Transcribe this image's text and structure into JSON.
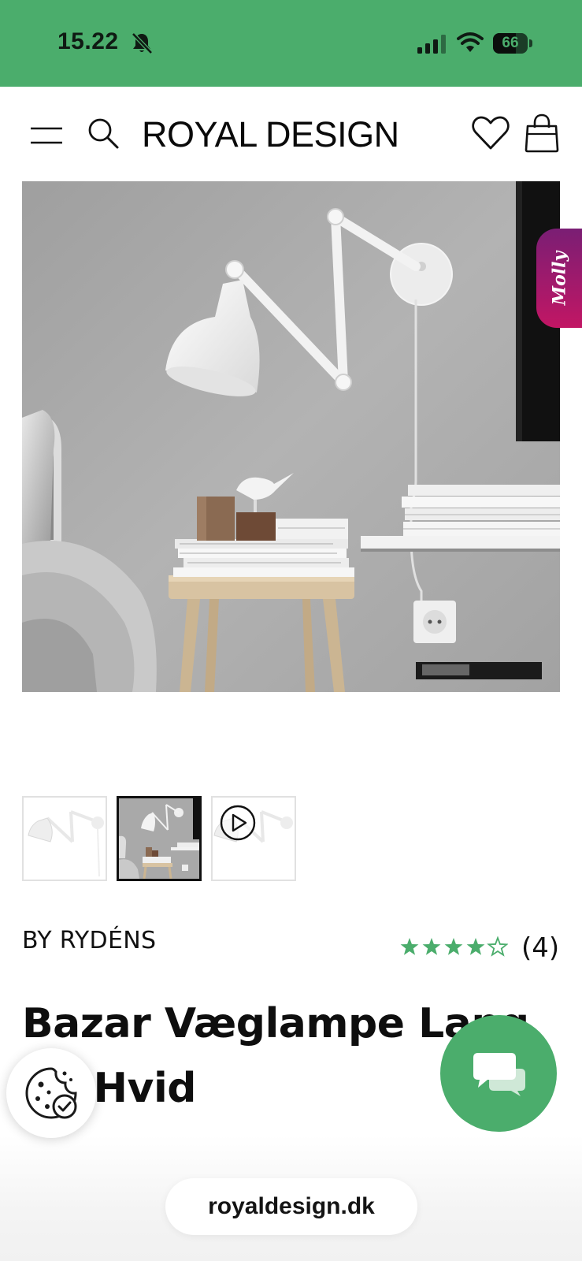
{
  "status_bar": {
    "time": "15.22",
    "battery_level": "66",
    "background_color": "#4bad6c",
    "icons": [
      "bell-slash-icon",
      "cellular-signal-icon",
      "wifi-icon",
      "battery-icon"
    ]
  },
  "header": {
    "logo": "ROYAL DESIGN",
    "icons": [
      "menu-icon",
      "search-icon",
      "heart-icon",
      "shopping-bag-icon"
    ]
  },
  "gallery": {
    "thumbnails": [
      {
        "kind": "product-image",
        "active": false
      },
      {
        "kind": "room-image",
        "active": true
      },
      {
        "kind": "video",
        "active": false,
        "icon": "play-icon"
      }
    ]
  },
  "assistant_tab": {
    "label": "Molly",
    "color_top": "#7a1e74",
    "color_bottom": "#c21664"
  },
  "product": {
    "brand": "BY RYDÉNS",
    "title_line1": "Bazar Væglampe Lang",
    "title_line2": "m, Hvid",
    "rating_value": 4,
    "rating_max": 5,
    "review_count": "(4)",
    "star_color": "#4bad6c"
  },
  "floating": {
    "cookie_icon": "cookie-settings-icon",
    "chat_icon": "chat-bubbles-icon",
    "chat_color": "#4bad6c"
  },
  "browser": {
    "url": "royaldesign.dk"
  }
}
